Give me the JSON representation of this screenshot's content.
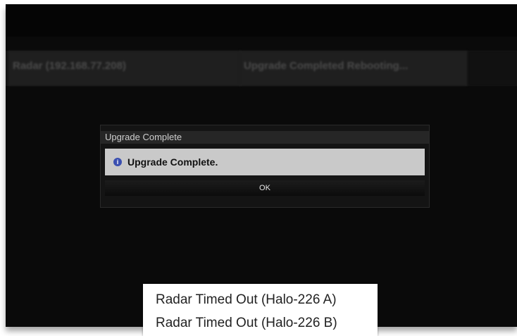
{
  "background_rows": {
    "left_cell": "Radar (192.168.77.208)",
    "right_cell": "Upgrade Completed Rebooting..."
  },
  "dialog": {
    "title": "Upgrade Complete",
    "icon": "info-icon",
    "message": "Upgrade Complete.",
    "ok_label": "OK"
  },
  "status_messages": [
    "Radar Timed Out (Halo-226 A)",
    "Radar Timed Out (Halo-226 B)"
  ],
  "colors": {
    "screen_bg": "#0a0a0a",
    "dialog_body": "#c9c9c9",
    "info_icon": "#3a4fb0"
  }
}
